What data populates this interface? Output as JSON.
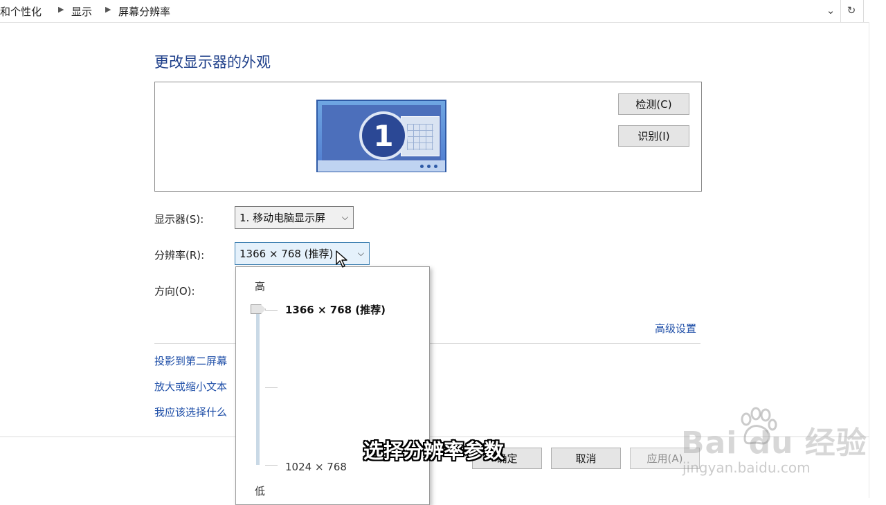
{
  "breadcrumb": [
    "和个性化",
    "显示",
    "屏幕分辨率"
  ],
  "page_title": "更改显示器的外观",
  "preview": {
    "monitor_number": "1"
  },
  "buttons": {
    "detect": "检测(C)",
    "identify": "识别(I)",
    "ok": "确定",
    "cancel": "取消",
    "apply": "应用(A)"
  },
  "fields": {
    "display_label": "显示器(S):",
    "display_value": "1. 移动电脑显示屏",
    "resolution_label": "分辨率(R):",
    "resolution_value": "1366 × 768 (推荐)",
    "orientation_label": "方向(O):"
  },
  "advanced_link": "高级设置",
  "links": [
    "投影到第二屏幕",
    "放大或缩小文本",
    "我应该选择什么"
  ],
  "resolution_dropdown": {
    "high_label": "高",
    "low_label": "低",
    "selected": "1366 × 768 (推荐)",
    "min_option": "1024 × 768",
    "slider_fraction": 1.0
  },
  "caption": "选择分辨率参数",
  "watermark": {
    "brand": "Bai du 经验",
    "url": "jingyan.baidu.com"
  },
  "colors": {
    "heading": "#1e3f8a",
    "link": "#1f4fa8",
    "monitor": "#4f7bcf"
  }
}
